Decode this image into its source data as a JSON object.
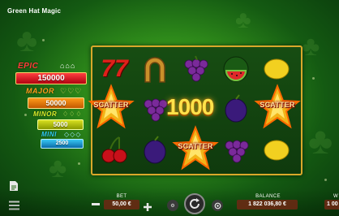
{
  "game": {
    "title": "Green Hat Magic"
  },
  "jackpots": [
    {
      "name": "EPIC",
      "value": "150000",
      "color": "#e8202a"
    },
    {
      "name": "MAJOR",
      "value": "50000",
      "color": "#f28a14"
    },
    {
      "name": "MINOR",
      "value": "5000",
      "color": "#c6d61a"
    },
    {
      "name": "MINI",
      "value": "2500",
      "color": "#1fb5e6"
    }
  ],
  "reels": {
    "symbols": [
      [
        "sevens",
        "horseshoe",
        "grapes",
        "watermelon",
        "lemon"
      ],
      [
        "scatter",
        "grapes",
        "",
        "plum",
        "scatter"
      ],
      [
        "cherries",
        "plum",
        "scatter",
        "grapes",
        "lemon"
      ]
    ],
    "scatter_label": "SCATTER"
  },
  "win": {
    "amount": "1000"
  },
  "controls": {
    "bet_label": "BET",
    "bet_value": "50,00 €",
    "balance_label": "BALANCE",
    "balance_value": "1 822 036,80 €",
    "win_label_partial": "W",
    "win_value_partial": "1 00"
  }
}
